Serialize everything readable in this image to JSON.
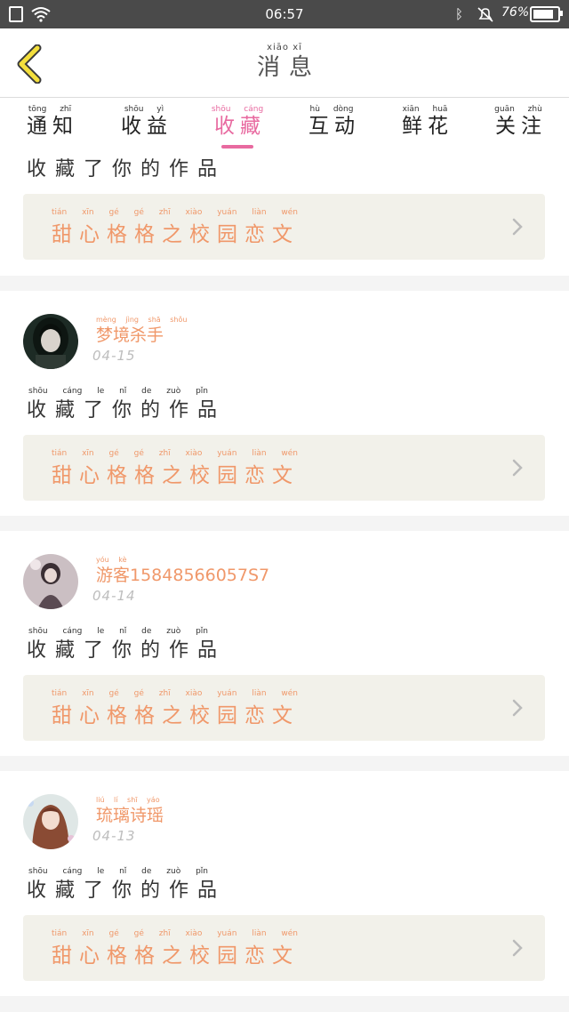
{
  "status_bar": {
    "time": "06:57",
    "battery": "76%",
    "icons": [
      "sim-icon",
      "wifi-icon",
      "bluetooth-icon",
      "mute-bell-icon",
      "battery-icon"
    ]
  },
  "header": {
    "title_pinyin": "xiāo xī",
    "title": "消息",
    "back_icon": "back-chevron-icon"
  },
  "tabs": [
    {
      "pinyin": "tōng zhī",
      "label": "通知",
      "active": false
    },
    {
      "pinyin": "shōu yì",
      "label": "收益",
      "active": false
    },
    {
      "pinyin": "shōu cáng",
      "label": "收藏",
      "active": true
    },
    {
      "pinyin": "hù dòng",
      "label": "互动",
      "active": false
    },
    {
      "pinyin": "xiān huā",
      "label": "鲜花",
      "active": false
    },
    {
      "pinyin": "guān zhù",
      "label": "关注",
      "active": false
    }
  ],
  "colors": {
    "accent_pink": "#e86aa0",
    "accent_orange": "#f0986a",
    "status_bar": "#4a4a4a",
    "work_box_bg": "#f2f1ea"
  },
  "items": [
    {
      "action": "收藏了你的作品",
      "work_pinyin": "tián xīn gé gé zhī xiào yuán liàn wén",
      "work_title": "甜心格格之校园恋文"
    },
    {
      "username_pinyin": "mèng jìng shā shǒu",
      "username": "梦境杀手",
      "date": "04-15",
      "action_pinyin": "shōu cáng le nǐ de zuò pǐn",
      "action": "收藏了你的作品",
      "work_pinyin": "tián xīn gé gé zhī xiào yuán liàn wén",
      "work_title": "甜心格格之校园恋文"
    },
    {
      "username_pinyin": "yóu kè",
      "username": "游客15848566057S7",
      "date": "04-14",
      "action_pinyin": "shōu cáng le nǐ de zuò pǐn",
      "action": "收藏了你的作品",
      "work_pinyin": "tián xīn gé gé zhī xiào yuán liàn wén",
      "work_title": "甜心格格之校园恋文"
    },
    {
      "username_pinyin": "liú lí shī yáo",
      "username": "琉璃诗瑶",
      "date": "04-13",
      "action_pinyin": "shōu cáng le nǐ de zuò pǐn",
      "action": "收藏了你的作品",
      "work_pinyin": "tián xīn gé gé zhī xiào yuán liàn wén",
      "work_title": "甜心格格之校园恋文"
    }
  ]
}
